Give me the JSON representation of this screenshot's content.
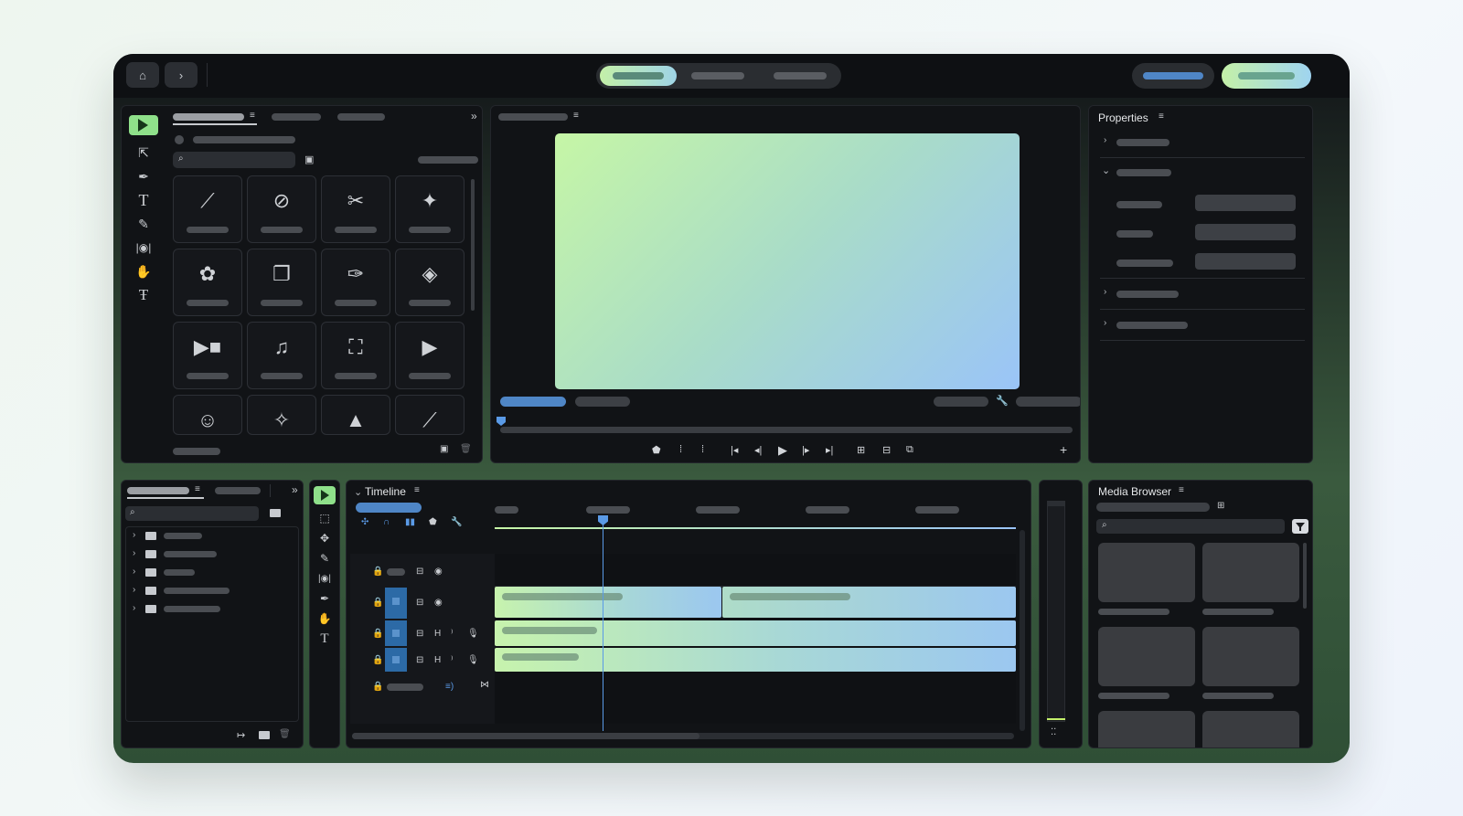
{
  "panels": {
    "properties_title": "Properties",
    "timeline_title": "Timeline",
    "media_browser_title": "Media Browser"
  },
  "colors": {
    "accent_green": "#8fe08a",
    "accent_blue": "#4f8fd6",
    "preview_gradient_start": "#c6f6a6",
    "preview_gradient_end": "#9ac4f8"
  },
  "icons": {
    "home": "home-icon",
    "forward": "chevron-right-icon",
    "menu": "hamburger-icon",
    "expand": "double-chevron-icon",
    "search": "search-icon",
    "folder": "folder-icon"
  },
  "preview": {
    "playhead_progress": 0.0
  },
  "timeline": {
    "playhead_fraction": 0.21
  }
}
